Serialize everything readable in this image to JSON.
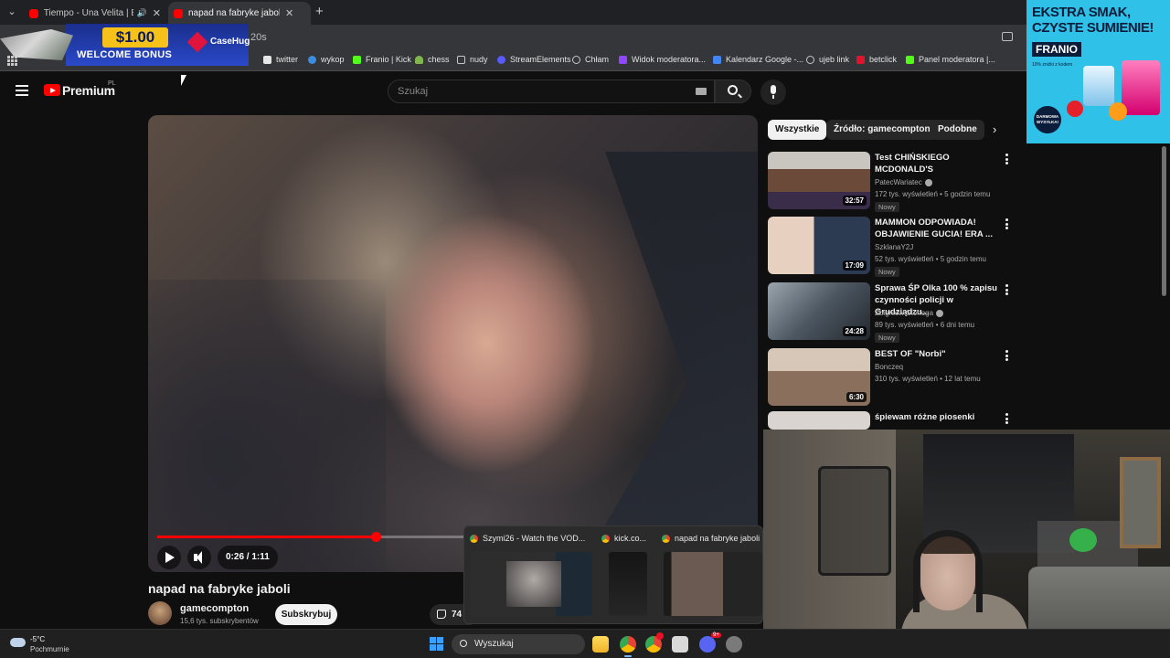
{
  "browser": {
    "tabs": [
      {
        "title": "Tiempo - Una Velita | Extended",
        "active": false,
        "muted_audio": true
      },
      {
        "title": "napad na fabryke jaboli - YouTube",
        "active": true
      }
    ],
    "url_fragment": "20s",
    "bookmarks": [
      {
        "label": "twitter",
        "icon": "x-icon"
      },
      {
        "label": "wykop",
        "icon": "wykop-icon"
      },
      {
        "label": "Franio | Kick",
        "icon": "kick-icon"
      },
      {
        "label": "chess",
        "icon": "pawn-icon"
      },
      {
        "label": "nudy",
        "icon": "folder-icon"
      },
      {
        "label": "StreamElements",
        "icon": "streamelements-icon"
      },
      {
        "label": "Chłam",
        "icon": "globe-icon"
      },
      {
        "label": "Widok moderatora...",
        "icon": "twitch-icon"
      },
      {
        "label": "Kalendarz Google -...",
        "icon": "calendar-icon"
      },
      {
        "label": "ujeb link",
        "icon": "globe-icon"
      },
      {
        "label": "betclick",
        "icon": "betclick-icon"
      },
      {
        "label": "Panel moderatora |...",
        "icon": "kick-icon"
      }
    ]
  },
  "promo": {
    "amount": "$1.00",
    "text": "WELCOME BONUS",
    "brand": "CaseHug"
  },
  "youtube": {
    "logo_text": "Premium",
    "region": "PL",
    "search_placeholder": "Szukaj"
  },
  "player": {
    "time": "0:26 / 1:11",
    "progress": 0.37
  },
  "video": {
    "title": "napad na fabryke jaboli",
    "channel": "gamecompton",
    "subscribers": "15,6 tys. subskrybentów",
    "subscribe_label": "Subskrybuj",
    "likes": "74"
  },
  "chips": [
    "Wszystkie",
    "Źródło: gamecompton",
    "Podobne"
  ],
  "recommendations": [
    {
      "title": "Test CHIŃSKIEGO MCDONALD'S",
      "channel": "PatecWariatec",
      "verified": true,
      "meta": "172 tys. wyświetleń • 5 godzin temu",
      "badge": "Nowy",
      "duration": "32:57"
    },
    {
      "title": "MAMMON ODPOWIADA! OBJAWIENIE GUCIA! ERA ...",
      "channel": "SzklanaY2J",
      "verified": false,
      "meta": "52 tys. wyświetleń • 5 godzin temu",
      "badge": "Nowy",
      "duration": "17:09"
    },
    {
      "title": "Sprawa ŚP Olka 100 % zapisu czynności policji w Grudziądzu...",
      "channel": "Zbigniew Stonoga",
      "verified": true,
      "meta": "89 tys. wyświetleń • 6 dni temu",
      "badge": "Nowy",
      "duration": "24:28"
    },
    {
      "title": "BEST OF \"Norbi\"",
      "channel": "Bonczeq",
      "verified": false,
      "meta": "310 tys. wyświetleń • 12 lat temu",
      "badge": "",
      "duration": "6:30"
    },
    {
      "title": "śpiewam różne piosenki",
      "channel": "",
      "verified": false,
      "meta": "",
      "badge": "",
      "duration": ""
    }
  ],
  "ad": {
    "headline": "EKSTRA SMAK, CZYSTE SUMIENIE!",
    "brand": "FRANIO",
    "sub": "10% zniżki z kodem",
    "stamp": "DARMOWA WYSYŁKA!"
  },
  "task_preview": [
    {
      "title": "Szymi26 - Watch the VOD..."
    },
    {
      "title": "kick.co..."
    },
    {
      "title": "napad na fabryke jaboli"
    }
  ],
  "taskbar": {
    "temperature": "-5°C",
    "condition": "Pochmurnie",
    "search_placeholder": "Wyszukaj",
    "discord_badge": "9+"
  },
  "colors": {
    "youtube_red": "#ff0000",
    "background": "#0f0f0f",
    "ad_background": "#2fc1e8"
  }
}
